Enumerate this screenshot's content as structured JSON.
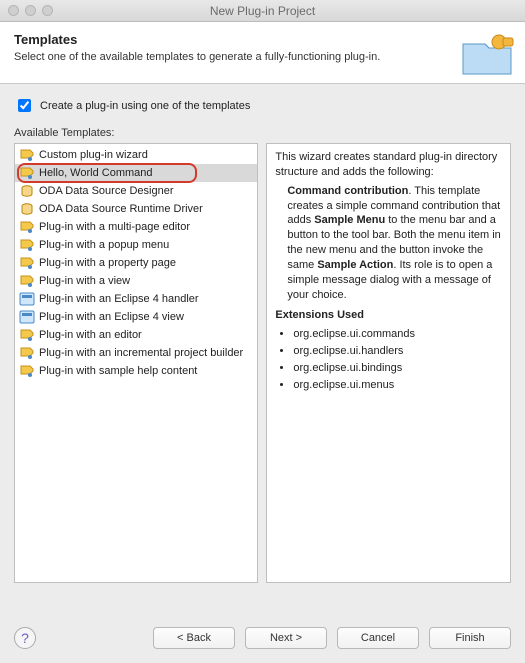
{
  "window": {
    "title": "New Plug-in Project"
  },
  "header": {
    "title": "Templates",
    "subtitle": "Select one of the available templates to generate a fully-functioning plug-in."
  },
  "checkbox": {
    "label": "Create a plug-in using one of the templates",
    "checked": true
  },
  "available_label": "Available Templates:",
  "templates": [
    {
      "label": "Custom plug-in wizard",
      "icon": "wizard"
    },
    {
      "label": "Hello, World Command",
      "icon": "wizard",
      "selected": true,
      "highlighted": true
    },
    {
      "label": "ODA Data Source Designer",
      "icon": "datasource"
    },
    {
      "label": "ODA Data Source Runtime Driver",
      "icon": "datasource"
    },
    {
      "label": "Plug-in with a multi-page editor",
      "icon": "wizard"
    },
    {
      "label": "Plug-in with a popup menu",
      "icon": "wizard"
    },
    {
      "label": "Plug-in with a property page",
      "icon": "wizard"
    },
    {
      "label": "Plug-in with a view",
      "icon": "wizard"
    },
    {
      "label": "Plug-in with an Eclipse 4 handler",
      "icon": "e4"
    },
    {
      "label": "Plug-in with an Eclipse 4 view",
      "icon": "e4"
    },
    {
      "label": "Plug-in with an editor",
      "icon": "wizard"
    },
    {
      "label": "Plug-in with an incremental project builder",
      "icon": "wizard"
    },
    {
      "label": "Plug-in with sample help content",
      "icon": "wizard"
    }
  ],
  "description": {
    "intro": "This wizard creates standard plug-in directory structure and adds the following:",
    "para_lead": "Command contribution",
    "para_mid1": ". This template creates a simple command contribution that adds ",
    "para_bold2": "Sample Menu",
    "para_mid2": " to the menu bar and a button to the tool bar. Both the menu item in the new menu and the button invoke the same ",
    "para_bold3": "Sample Action",
    "para_tail": ". Its role is to open a simple message dialog with a message of your choice.",
    "ext_heading": "Extensions Used",
    "extensions": [
      "org.eclipse.ui.commands",
      "org.eclipse.ui.handlers",
      "org.eclipse.ui.bindings",
      "org.eclipse.ui.menus"
    ]
  },
  "buttons": {
    "back": "< Back",
    "next": "Next >",
    "cancel": "Cancel",
    "finish": "Finish"
  }
}
